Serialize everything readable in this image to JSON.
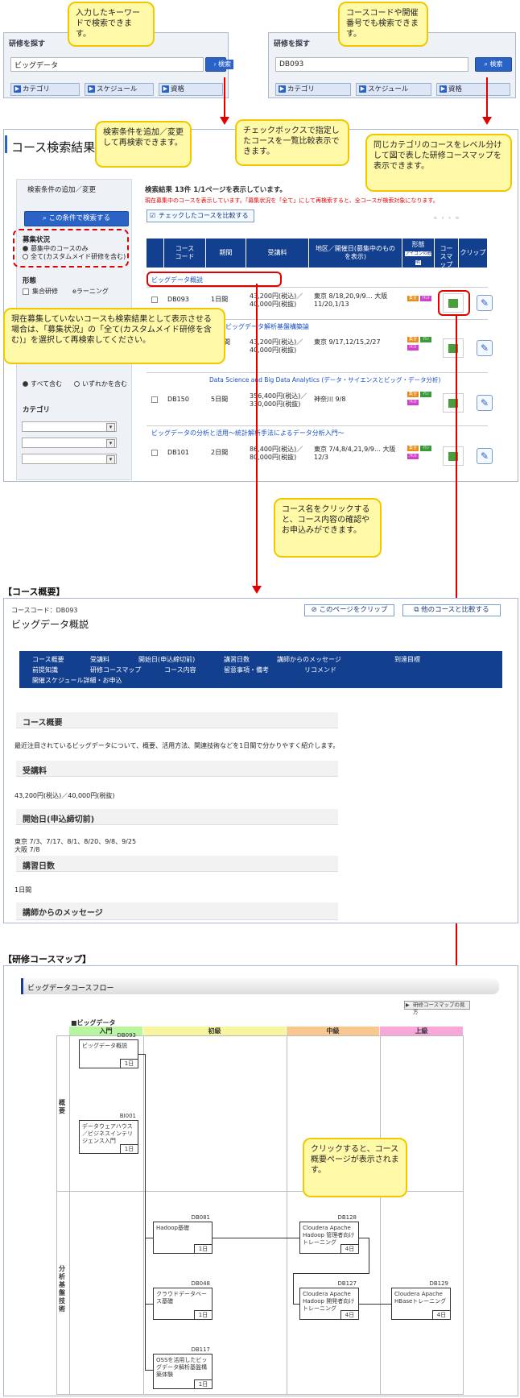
{
  "search_left": {
    "title": "研修を探す",
    "input_value": "ビッグデータ",
    "search_button": "検索",
    "nav": [
      "カテゴリ",
      "スケジュール",
      "資格"
    ]
  },
  "search_right": {
    "title": "研修を探す",
    "input_value": "DB093",
    "search_button": "検索",
    "nav": [
      "カテゴリ",
      "スケジュール",
      "資格"
    ]
  },
  "callouts": {
    "keyword": "入力したキーワードで検索できます。",
    "course_code": "コースコードや開催番号でも検索できます。",
    "add_criteria": "検索条件を追加／変更して再検索できます。",
    "compare": "チェックボックスで指定したコースを一覧比較表示できます。",
    "coursemap": "同じカテゴリのコースをレベル分けして図で表した研修コースマップを表示できます。",
    "recruit": "現在募集していないコースも検索結果として表示させる場合は、「募集状況」の「全て(カスタムメイド研修を含む)」を選択して再検索してください。",
    "course_name": "コース名をクリックすると、コース内容の確認やお申込みができます。",
    "click_map": "クリックすると、コース概要ページが表示されます。"
  },
  "results": {
    "title": "コース検索結果",
    "sidebar_title": "検索条件の追加／変更",
    "research_button": "この条件で検索する",
    "status_label": "募集状況",
    "status_options": [
      "募集中のコースのみ",
      "全て(カスタムメイド研修を含む)"
    ],
    "form_label": "形態",
    "form_options": [
      "集合研修",
      "eラーニング"
    ],
    "contain_options": [
      "すべて含む",
      "いずれかを含む"
    ],
    "category_label": "カテゴリ",
    "summary": "検索結果 13件 1/1ページを表示しています。",
    "notice": "現在募集中のコースを表示しています。「募集状況を「全て」にして再検索すると、全コースが検索対象になります。",
    "compare_button": "チェックしたコースを比較する",
    "columns": [
      "コースコード",
      "期間",
      "受講料",
      "地区／開催日(募集中のものを表示)",
      "形態",
      "コースマップ",
      "クリップ"
    ],
    "icon_note": "アイコンの説明",
    "rows": [
      {
        "group": "ビッグデータ概説",
        "code": "DB093",
        "period": "1日間",
        "fee": "43,200円(税込)／40,000円(税抜)",
        "dates": "東京 8/18,20,9/9… 大阪 11/20,1/13"
      },
      {
        "group": "ビッグデータ解析基盤構築論",
        "code": "DB…",
        "period": "…日間",
        "fee": "43,200円(税込)／40,000円(税抜)",
        "dates": "東京 9/17,12/15,2/27"
      },
      {
        "group": "Data Science and Big Data Analytics (データ・サイエンスとビッグ・データ分析)",
        "code": "DB150",
        "period": "5日間",
        "fee": "356,400円(税込)／330,000円(税抜)",
        "dates": "神奈川 9/8"
      },
      {
        "group": "ビッグデータの分析と活用～統計解析手法によるデータ分析入門～",
        "code": "DB101",
        "period": "2日間",
        "fee": "86,400円(税込)／80,000円(税抜)",
        "dates": "東京 7/4,8/4,21,9/9… 大阪 12/3"
      }
    ]
  },
  "overview": {
    "section_label": "【コース概要】",
    "code_line": "コースコード：DB093",
    "title": "ビッグデータ概説",
    "clip_button": "このページをクリップ",
    "compare_button": "他のコースと比較する",
    "nav_row1": [
      "コース概要",
      "受講料",
      "開始日(申込締切前)",
      "講習日数",
      "講師からのメッセージ",
      "到達目標"
    ],
    "nav_row2": [
      "前提知識",
      "研修コースマップ",
      "コース内容",
      "留意事項・備考",
      "リコメンド"
    ],
    "nav_row3": [
      "開催スケジュール詳細・お申込"
    ],
    "h_overview": "コース概要",
    "t_overview": "最近注目されているビッグデータについて、概要、活用方法、関連技術などを1日間で分かりやすく紹介します。",
    "h_fee": "受講料",
    "t_fee": "43,200円(税込)／40,000円(税抜)",
    "h_start": "開始日(申込締切前)",
    "t_start1": "東京 7/3、7/17、8/1、8/20、9/8、9/25",
    "t_start2": "大阪 7/8",
    "h_days": "講習日数",
    "t_days": "1日間",
    "h_msg": "講師からのメッセージ"
  },
  "map": {
    "section_label": "【研修コースマップ】",
    "flow_title": "ビッグデータコースフロー",
    "howto_button": "研修コースマップの見方",
    "category": "■ビッグデータ",
    "levels": [
      "入門",
      "初級",
      "中級",
      "上級"
    ],
    "rows": [
      "概要",
      "分析基盤技術"
    ],
    "courses": [
      {
        "code": "DB093",
        "name": "ビッグデータ概説",
        "dur": "1日"
      },
      {
        "code": "BI001",
        "name": "データウェアハウス／ビジネスインテリジェンス入門",
        "dur": "1日"
      },
      {
        "code": "DB081",
        "name": "Hadoop基礎",
        "dur": "1日"
      },
      {
        "code": "DB128",
        "name": "Cloudera Apache Hadoop 管理者向けトレーニング",
        "dur": "4日"
      },
      {
        "code": "DB048",
        "name": "クラウドデータベース基礎",
        "dur": "1日"
      },
      {
        "code": "DB127",
        "name": "Cloudera Apache Hadoop 開発者向けトレーニング",
        "dur": "4日"
      },
      {
        "code": "DB129",
        "name": "Cloudera Apache HBaseトレーニング",
        "dur": "4日"
      },
      {
        "code": "DB117",
        "name": "OSSを活用したビッグデータ解析基盤構築体験",
        "dur": "1日"
      }
    ]
  },
  "colors": {
    "accent": "#2a63c5",
    "nav_dark": "#123f8e",
    "callout_bg": "#fff9a8",
    "arrow_red": "#e00000",
    "map_green": "#4a9e3c"
  }
}
